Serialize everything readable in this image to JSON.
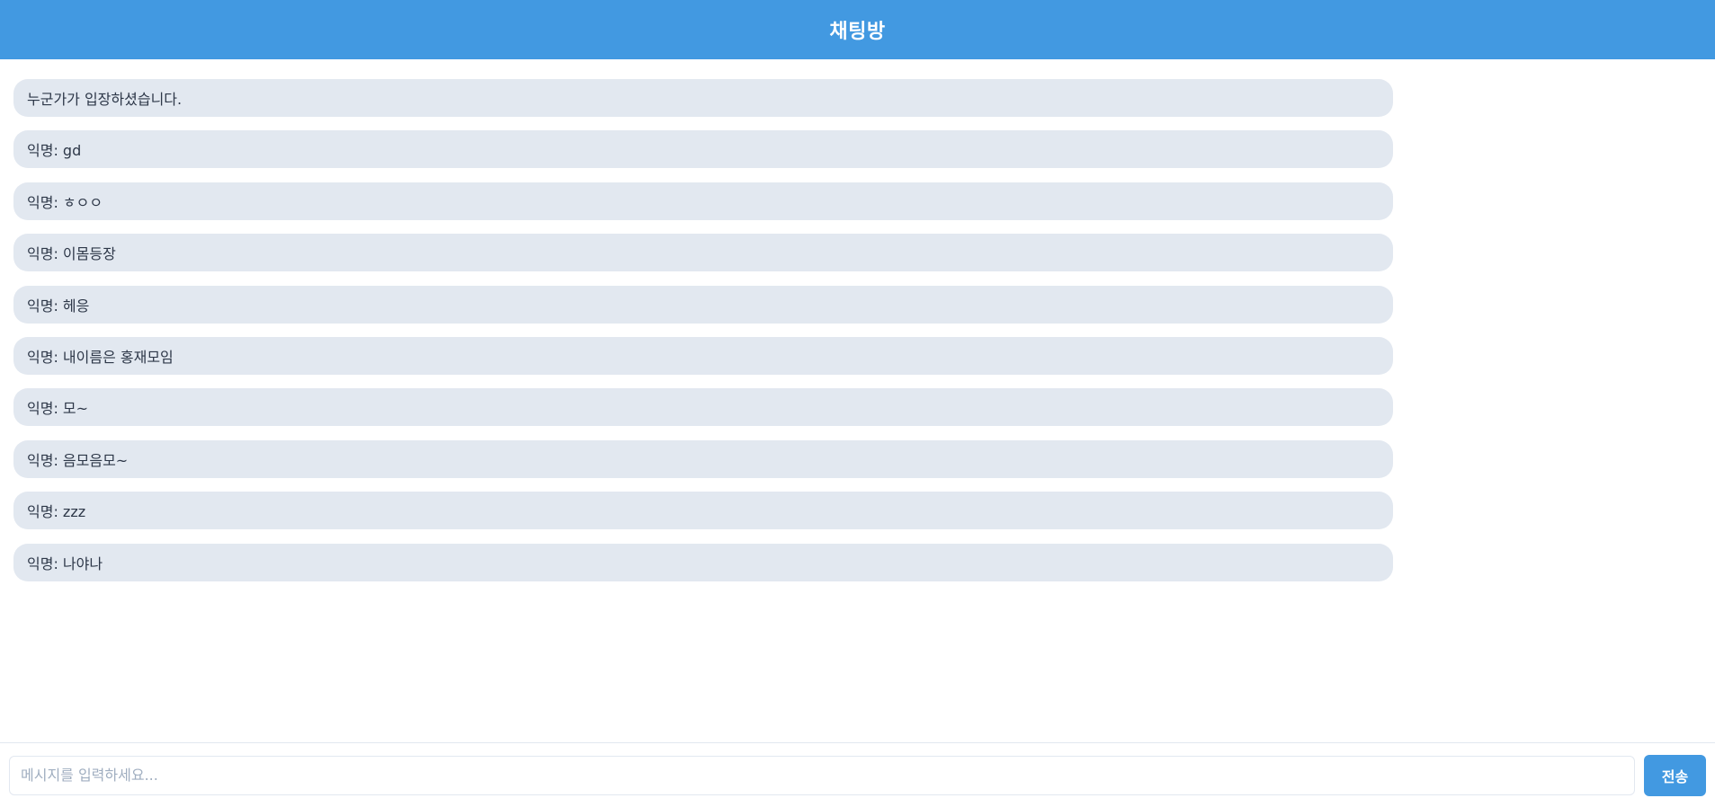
{
  "header": {
    "title": "채팅방"
  },
  "messages": [
    {
      "text": "누군가가 입장하셨습니다."
    },
    {
      "text": "익명: gd"
    },
    {
      "text": "익명: ㅎㅇㅇ"
    },
    {
      "text": "익명: 이몸등장"
    },
    {
      "text": "익명: 헤응"
    },
    {
      "text": "익명: 내이름은 홍재모임"
    },
    {
      "text": "익명: 모~"
    },
    {
      "text": "익명: 음모음모~"
    },
    {
      "text": "익명: zzz"
    },
    {
      "text": "익명: 나야나"
    }
  ],
  "composer": {
    "input_value": "",
    "input_placeholder": "메시지를 입력하세요...",
    "send_label": "전송"
  },
  "colors": {
    "header_bg": "#4299e1",
    "message_bg": "#e2e8f0",
    "send_button_bg": "#4299e1"
  }
}
